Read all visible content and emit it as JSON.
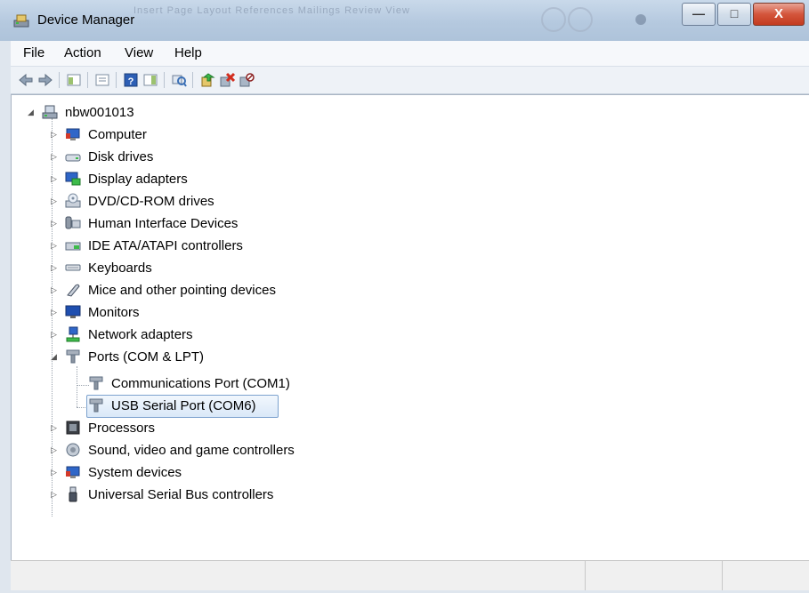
{
  "window": {
    "title": "Device Manager",
    "ghost_tabs": "Insert    Page Layout    References    Mailings    Review    View",
    "controls": {
      "minimize": "—",
      "maximize": "□",
      "close": "X"
    }
  },
  "menu": [
    "File",
    "Action",
    "View",
    "Help"
  ],
  "toolbar": [
    "back-icon",
    "forward-icon",
    "show-hide-tree-icon",
    "properties-icon",
    "help-icon",
    "action-pane-icon",
    "scan-hardware-icon",
    "update-driver-icon",
    "uninstall-icon",
    "disable-icon"
  ],
  "tree": {
    "root": {
      "label": "nbw001013",
      "expanded": true
    },
    "categories": [
      {
        "label": "Computer",
        "icon": "computer-icon",
        "expanded": false
      },
      {
        "label": "Disk drives",
        "icon": "disk-drive-icon",
        "expanded": false
      },
      {
        "label": "Display adapters",
        "icon": "display-adapter-icon",
        "expanded": false
      },
      {
        "label": "DVD/CD-ROM drives",
        "icon": "dvd-drive-icon",
        "expanded": false
      },
      {
        "label": "Human Interface Devices",
        "icon": "hid-icon",
        "expanded": false
      },
      {
        "label": "IDE ATA/ATAPI controllers",
        "icon": "ide-controller-icon",
        "expanded": false
      },
      {
        "label": "Keyboards",
        "icon": "keyboard-icon",
        "expanded": false
      },
      {
        "label": "Mice and other pointing devices",
        "icon": "mouse-icon",
        "expanded": false
      },
      {
        "label": "Monitors",
        "icon": "monitor-icon",
        "expanded": false
      },
      {
        "label": "Network adapters",
        "icon": "network-adapter-icon",
        "expanded": false
      },
      {
        "label": "Ports (COM & LPT)",
        "icon": "port-icon",
        "expanded": true,
        "children": [
          {
            "label": "Communications Port (COM1)",
            "icon": "port-icon",
            "selected": false
          },
          {
            "label": "USB Serial Port (COM6)",
            "icon": "port-icon",
            "selected": true
          }
        ]
      },
      {
        "label": "Processors",
        "icon": "processor-icon",
        "expanded": false
      },
      {
        "label": "Sound, video and game controllers",
        "icon": "sound-icon",
        "expanded": false
      },
      {
        "label": "System devices",
        "icon": "system-devices-icon",
        "expanded": false
      },
      {
        "label": "Universal Serial Bus controllers",
        "icon": "usb-icon",
        "expanded": false
      }
    ]
  },
  "colors": {
    "title_bar": "#b5c9df",
    "selection_border": "#7da2ce",
    "selection_fill": "#dae8f8",
    "close_button": "#d4553c"
  }
}
